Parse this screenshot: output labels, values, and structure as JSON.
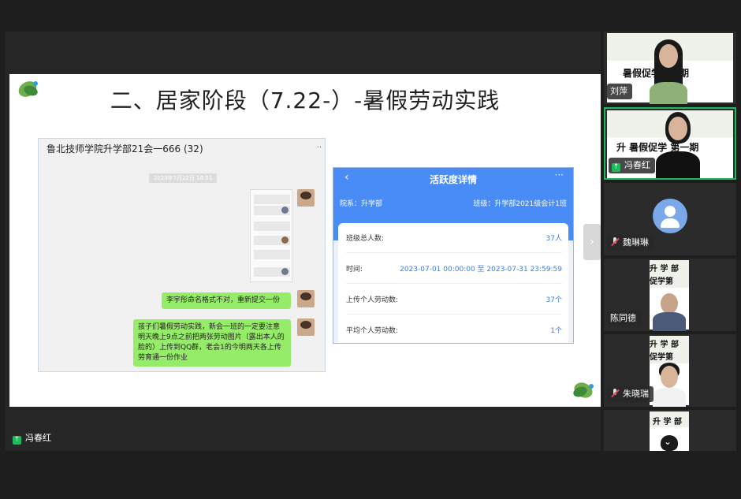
{
  "slide": {
    "title": "二、居家阶段（7.22-）-暑假劳动实践"
  },
  "chat": {
    "group_title": "鲁北技师学院升学部21会一666 (32)",
    "timestamp": "2023年7月22日 18:51",
    "message_1": "李宇彤命名格式不对，重新提交一份",
    "message_2": "孩子们暑假劳动实践，新会一班的一定要注意明天晚上9点之前把两张劳动图片（露出本人的脸的）上传到QQ群，老会1的今明两天各上传劳育通一份作业"
  },
  "activity_card": {
    "back_icon": "chevron-left-icon",
    "title": "活跃度详情",
    "more": "···",
    "department": "院系：升学部",
    "class_name": "班级：升学部2021级会计1班",
    "rows": [
      {
        "label": "班级总人数:",
        "value": "37人"
      },
      {
        "label": "时间:",
        "value": "2023-07-01 00:00:00 至 2023-07-31 23:59:59"
      },
      {
        "label": "上传个人劳动数:",
        "value": "37个"
      },
      {
        "label": "平均个人劳动数:",
        "value": "1个"
      }
    ]
  },
  "nav": {
    "next_arrow": "›"
  },
  "share": {
    "presenter_name": "冯春红",
    "icon": "screen-share-icon"
  },
  "participants": [
    {
      "name": "刘萍",
      "muted": false,
      "sign_text": "暑假促学第一期"
    },
    {
      "name": "冯春红",
      "muted": false,
      "active": true,
      "sign_text": "升 暑假促学 第一期"
    },
    {
      "name": "魏琳琳",
      "muted": true
    },
    {
      "name": "陈同德",
      "muted": false,
      "sign_text": "升 学 部 促学第"
    },
    {
      "name": "朱晓瑞",
      "muted": true,
      "sign_text": "升 学 部 促学第"
    },
    {
      "name": "",
      "muted": false,
      "sign_text": "升 学 部"
    }
  ],
  "colors": {
    "accent_green": "#1fb85a",
    "card_blue": "#4a8cf6",
    "bubble_green": "#95ec69"
  }
}
